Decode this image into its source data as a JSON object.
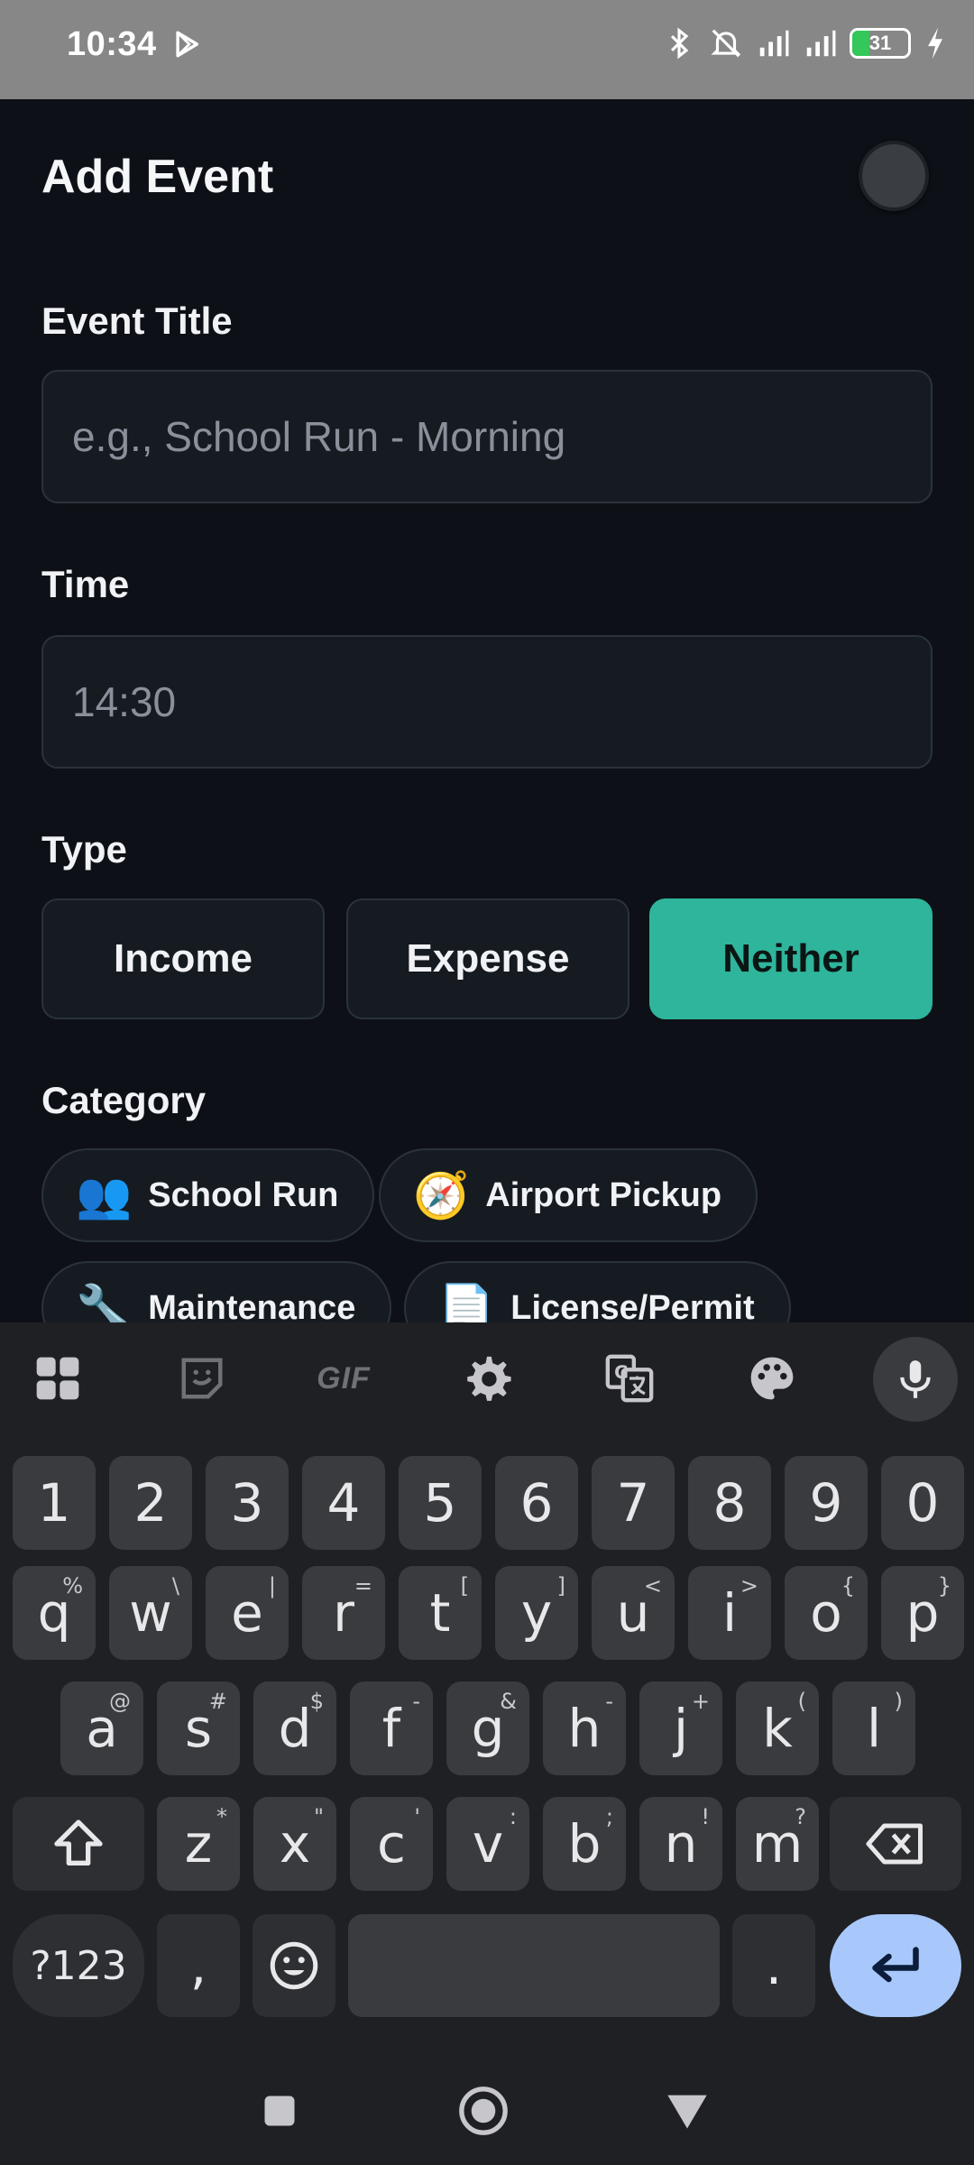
{
  "status_bar": {
    "time": "10:34",
    "battery_level": "31",
    "battery_fraction": 0.31,
    "icons": [
      "play-store-icon",
      "bluetooth-icon",
      "silent-mode-icon",
      "signal-icon",
      "signal-icon",
      "battery-icon",
      "charging-icon"
    ]
  },
  "header": {
    "title": "Add Event"
  },
  "form": {
    "event_title_label": "Event Title",
    "event_title_placeholder": "e.g., School Run - Morning",
    "event_title_value": "",
    "time_label": "Time",
    "time_placeholder": "14:30",
    "time_value": "",
    "type_label": "Type",
    "types": [
      {
        "label": "Income",
        "selected": false
      },
      {
        "label": "Expense",
        "selected": false
      },
      {
        "label": "Neither",
        "selected": true
      }
    ],
    "category_label": "Category",
    "categories": [
      {
        "emoji": "👥",
        "label": "School Run"
      },
      {
        "emoji": "🧭",
        "label": "Airport Pickup"
      },
      {
        "emoji": "🔧",
        "label": "Maintenance"
      },
      {
        "emoji": "📄",
        "label": "License/Permit"
      }
    ]
  },
  "colors": {
    "background": "#0d1117",
    "field": "#161b22",
    "accent": "#2fb59c",
    "keyboard": "#1f2023",
    "enter_key": "#a8c7fa"
  },
  "keyboard": {
    "toolbar": [
      "apps-grid-icon",
      "sticker-icon",
      "GIF",
      "settings-icon",
      "translate-icon",
      "palette-icon",
      "microphone-icon"
    ],
    "number_row": [
      "1",
      "2",
      "3",
      "4",
      "5",
      "6",
      "7",
      "8",
      "9",
      "0"
    ],
    "row1": [
      {
        "k": "q",
        "h": "%"
      },
      {
        "k": "w",
        "h": "\\"
      },
      {
        "k": "e",
        "h": "|"
      },
      {
        "k": "r",
        "h": "="
      },
      {
        "k": "t",
        "h": "["
      },
      {
        "k": "y",
        "h": "]"
      },
      {
        "k": "u",
        "h": "<"
      },
      {
        "k": "i",
        "h": ">"
      },
      {
        "k": "o",
        "h": "{"
      },
      {
        "k": "p",
        "h": "}"
      }
    ],
    "row2": [
      {
        "k": "a",
        "h": "@"
      },
      {
        "k": "s",
        "h": "#"
      },
      {
        "k": "d",
        "h": "$"
      },
      {
        "k": "f",
        "h": "-"
      },
      {
        "k": "g",
        "h": "&"
      },
      {
        "k": "h",
        "h": "-"
      },
      {
        "k": "j",
        "h": "+"
      },
      {
        "k": "k",
        "h": "("
      },
      {
        "k": "l",
        "h": ")"
      }
    ],
    "row3": [
      {
        "k": "z",
        "h": "*"
      },
      {
        "k": "x",
        "h": "\""
      },
      {
        "k": "c",
        "h": "'"
      },
      {
        "k": "v",
        "h": ":"
      },
      {
        "k": "b",
        "h": ";"
      },
      {
        "k": "n",
        "h": "!"
      },
      {
        "k": "m",
        "h": "?"
      }
    ],
    "sym_label": "?123",
    "comma": ",",
    "period": "."
  }
}
